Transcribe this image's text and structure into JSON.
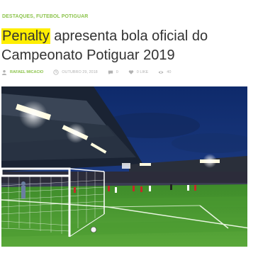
{
  "categories": {
    "first": "DESTAQUES",
    "separator": ", ",
    "second": "FUTEBOL POTIGUAR"
  },
  "article": {
    "title_highlight": "Penalty",
    "title_rest": " apresenta bola oficial do Campeonato Potiguar 2019"
  },
  "meta": {
    "author": "RAFAEL MICACIO",
    "date": "OUTUBRO 29, 2018",
    "comments": "0",
    "likes": "0 LIKE",
    "views": "40"
  },
  "colors": {
    "accent": "#8bc34a",
    "highlight": "#ffee00"
  },
  "icons": {
    "author": "user-icon",
    "date": "clock-icon",
    "comments": "comment-bubble-icon",
    "likes": "heart-icon",
    "views": "eye-icon"
  }
}
